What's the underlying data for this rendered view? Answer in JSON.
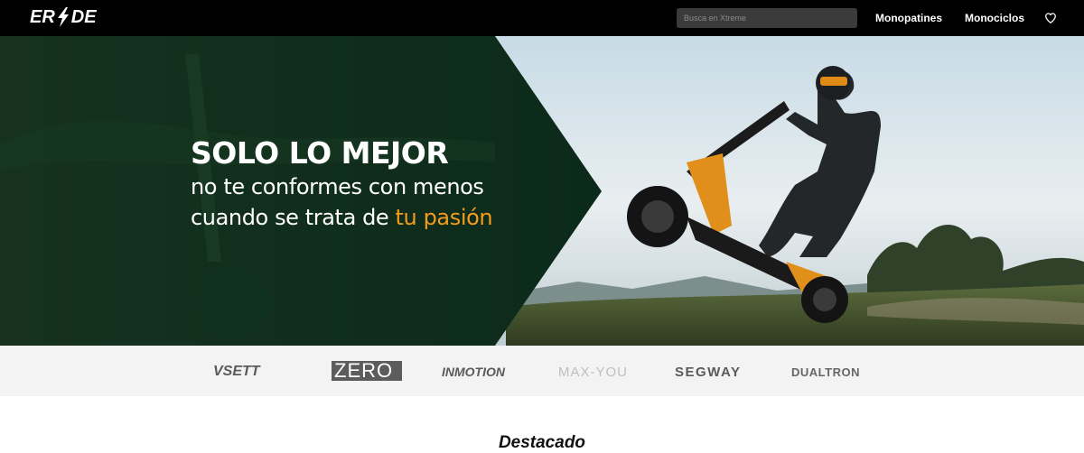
{
  "header": {
    "logo": {
      "left": "ER",
      "right": "DE"
    },
    "search": {
      "placeholder": "Busca en Xtreme"
    },
    "nav": [
      "Monopatines",
      "Monociclos"
    ],
    "wishlist_icon": "heart-icon"
  },
  "hero": {
    "headline": "SOLO LO MEJOR",
    "line1": "no te conformes con menos",
    "line2_prefix": "cuando se trata de ",
    "line2_accent": "tu pasión",
    "colors": {
      "overlay": "#0d2b1d",
      "accent": "#f39c1c"
    }
  },
  "brands": [
    "VSETT",
    "ZERO",
    "INMOTION",
    "MAX-YOU",
    "SEGWAY",
    "DUALTRON"
  ],
  "featured": {
    "title": "Destacado"
  }
}
